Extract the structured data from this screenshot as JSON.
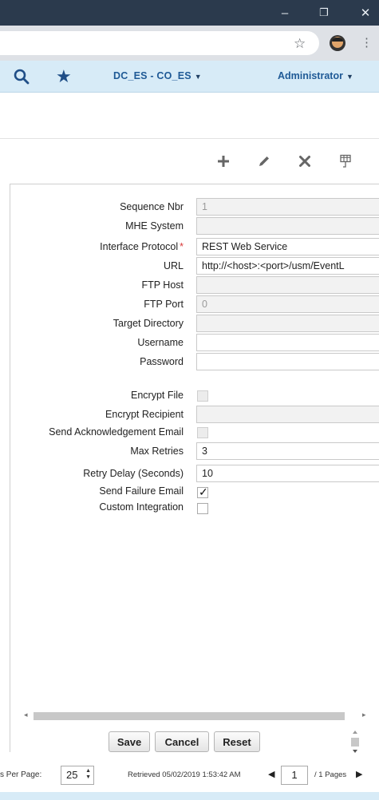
{
  "window": {
    "minimize_glyph": "–",
    "maximize_glyph": "❐",
    "close_glyph": "✕"
  },
  "browser": {
    "bookmark_icon": "star-outline-icon",
    "menu_glyph": "⋮"
  },
  "header": {
    "facility": "DC_ES - CO_ES",
    "user": "Administrator",
    "icons": [
      "search-icon",
      "favorites-star-icon"
    ],
    "accent_color": "#1f5a96"
  },
  "toolbar": {
    "icons": [
      "add-icon",
      "edit-icon",
      "delete-icon",
      "grid-config-icon"
    ]
  },
  "form": {
    "sequence_nbr": {
      "label": "Sequence Nbr",
      "value": "1"
    },
    "mhe_system": {
      "label": "MHE System",
      "value": ""
    },
    "interface_protocol": {
      "label": "Interface Protocol",
      "required_mark": "*",
      "value": "REST Web Service"
    },
    "url": {
      "label": "URL",
      "value": "http://<host>:<port>/usm/EventL"
    },
    "ftp_host": {
      "label": "FTP Host",
      "value": ""
    },
    "ftp_port": {
      "label": "FTP Port",
      "value": "0"
    },
    "target_directory": {
      "label": "Target Directory",
      "value": ""
    },
    "username": {
      "label": "Username",
      "value": ""
    },
    "password": {
      "label": "Password",
      "value": ""
    },
    "encrypt_file": {
      "label": "Encrypt File",
      "checked": false
    },
    "encrypt_recipient": {
      "label": "Encrypt Recipient",
      "value": ""
    },
    "send_ack_email": {
      "label": "Send Acknowledgement Email",
      "checked": false
    },
    "max_retries": {
      "label": "Max Retries",
      "value": "3"
    },
    "retry_delay": {
      "label": "Retry Delay (Seconds)",
      "value": "10"
    },
    "send_failure_email": {
      "label": "Send Failure Email",
      "checked": true,
      "mark": "✓"
    },
    "custom_integration": {
      "label": "Custom Integration",
      "checked": false
    }
  },
  "actions": {
    "save": "Save",
    "cancel": "Cancel",
    "reset": "Reset"
  },
  "footer": {
    "per_page_label": "s Per Page:",
    "per_page_value": "25",
    "retrieved": "Retrieved 05/02/2019 1:53:42 AM",
    "page_value": "1",
    "page_total": "/ 1 Pages"
  }
}
